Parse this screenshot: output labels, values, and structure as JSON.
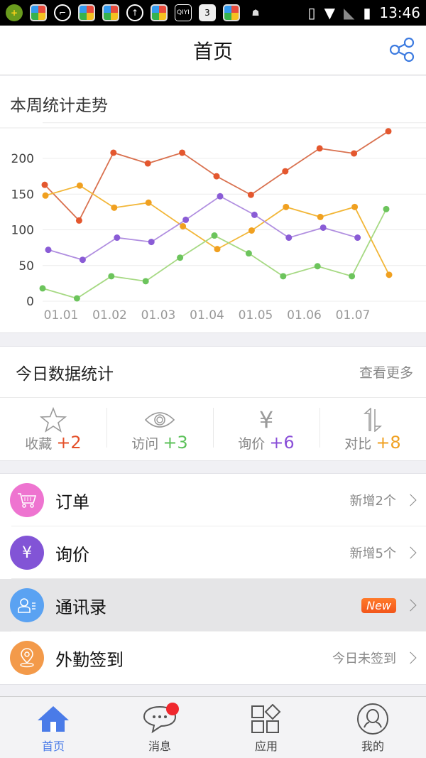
{
  "status_bar": {
    "time": "13:46",
    "left_icons": [
      "360-security-icon",
      "app-icon",
      "sunglasses-icon",
      "app-icon",
      "app-icon",
      "upload-icon",
      "app-icon",
      "iqiyi-icon",
      "calendar-icon",
      "app-icon",
      "android-icon"
    ],
    "calendar_day": "3",
    "iqiyi_label": "QIYI",
    "right_icons": [
      "vibrate-icon",
      "wifi-icon",
      "no-sim-icon",
      "battery-charging-icon"
    ]
  },
  "header": {
    "title": "首页",
    "share_icon": "share-icon"
  },
  "weekly_chart": {
    "title": "本周统计走势"
  },
  "chart_data": {
    "type": "line",
    "title": "本周统计走势",
    "xlabel": "",
    "ylabel": "",
    "x_tick_labels": [
      "01.01",
      "01.02",
      "01.03",
      "01.04",
      "01.05",
      "01.06",
      "01.07"
    ],
    "y_ticks": [
      0,
      50,
      100,
      150,
      200
    ],
    "ylim": [
      0,
      240
    ],
    "grid": true,
    "legend": "none",
    "series": [
      {
        "name": "red",
        "color": "#e4572e",
        "line_color": "#d9714f",
        "values": [
          163,
          113,
          208,
          193,
          208,
          175,
          149,
          182,
          214,
          207,
          238
        ]
      },
      {
        "name": "orange",
        "color": "#f0a020",
        "line_color": "#f2b637",
        "values": [
          148,
          162,
          131,
          138,
          105,
          73,
          99,
          132,
          118,
          132,
          37
        ]
      },
      {
        "name": "purple",
        "color": "#8a5cd6",
        "line_color": "#b08ee0",
        "values": [
          72,
          58,
          89,
          83,
          114,
          147,
          121,
          89,
          103,
          89
        ]
      },
      {
        "name": "green",
        "color": "#6cc45c",
        "line_color": "#a6d983",
        "values": [
          18,
          4,
          35,
          28,
          61,
          92,
          67,
          35,
          49,
          35,
          129
        ]
      }
    ]
  },
  "today": {
    "title": "今日数据统计",
    "more_label": "查看更多",
    "stats": [
      {
        "icon": "star-icon",
        "label": "收藏",
        "value": "+2",
        "color": "#e4502a"
      },
      {
        "icon": "eye-icon",
        "label": "访问",
        "value": "+3",
        "color": "#5cc15a"
      },
      {
        "icon": "yen-icon",
        "label": "询价",
        "value": "+6",
        "color": "#8a4fd8"
      },
      {
        "icon": "compare-arrows-icon",
        "label": "对比",
        "value": "+8",
        "color": "#f0a020"
      }
    ]
  },
  "list": [
    {
      "icon": "cart-icon",
      "label": "订单",
      "right": "新增2个",
      "color": "#ee74d0"
    },
    {
      "icon": "yen-icon",
      "label": "询价",
      "right": "新增5个",
      "color": "#8254d6"
    },
    {
      "icon": "contacts-icon",
      "label": "通讯录",
      "badge": "New",
      "color": "#5aa2f2"
    },
    {
      "icon": "location-pin-icon",
      "label": "外勤签到",
      "right": "今日未签到",
      "color": "#f39a4a"
    }
  ],
  "tabbar": {
    "tabs": [
      {
        "icon": "home-icon",
        "label": "首页",
        "active": true
      },
      {
        "icon": "message-icon",
        "label": "消息",
        "badge_dot": true
      },
      {
        "icon": "apps-icon",
        "label": "应用"
      },
      {
        "icon": "user-icon",
        "label": "我的"
      }
    ]
  }
}
